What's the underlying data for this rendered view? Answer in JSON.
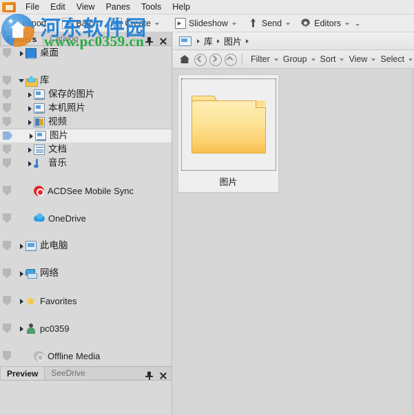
{
  "menu": {
    "logo_icon": "acdsee-logo-icon",
    "items": [
      {
        "label": "File"
      },
      {
        "label": "Edit"
      },
      {
        "label": "View"
      },
      {
        "label": "Panes"
      },
      {
        "label": "Tools"
      },
      {
        "label": "Help"
      }
    ]
  },
  "toolbar": {
    "buttons": [
      {
        "label": "Import",
        "icon": "import-icon",
        "has_caret": false
      },
      {
        "label": "Batch",
        "icon": "batch-icon",
        "has_caret": false
      },
      {
        "label": "Create",
        "icon": "create-icon",
        "has_caret": true
      },
      {
        "label": "Slideshow",
        "icon": "slideshow-icon",
        "has_caret": true
      },
      {
        "label": "Send",
        "icon": "send-icon",
        "has_caret": true
      },
      {
        "label": "Editors",
        "icon": "editors-icon",
        "has_caret": true
      }
    ],
    "overflow_caret": "chevron-down-icon"
  },
  "left_panel": {
    "tabs": [
      {
        "label": "Folders",
        "active": true
      },
      {
        "label": "Catalog",
        "active": false
      }
    ],
    "pin_icon": "pin-icon",
    "close_icon": "close-icon",
    "tree": [
      {
        "label": "桌面",
        "icon": "desktop-icon",
        "indent": 0,
        "arrow": "closed",
        "selected": false,
        "badge": true
      },
      {
        "label": "",
        "icon": "spacer",
        "indent": 0,
        "arrow": "none",
        "selected": false,
        "badge": false,
        "spacer": true
      },
      {
        "label": "库",
        "icon": "library-icon",
        "indent": 0,
        "arrow": "open",
        "selected": false,
        "badge": true
      },
      {
        "label": "保存的图片",
        "icon": "pictures-icon",
        "indent": 1,
        "arrow": "closed",
        "selected": false,
        "badge": true
      },
      {
        "label": "本机照片",
        "icon": "pictures-icon",
        "indent": 1,
        "arrow": "closed",
        "selected": false,
        "badge": true
      },
      {
        "label": "视频",
        "icon": "video-icon",
        "indent": 1,
        "arrow": "closed",
        "selected": false,
        "badge": true
      },
      {
        "label": "图片",
        "icon": "pictures-icon",
        "indent": 1,
        "arrow": "closed",
        "selected": true,
        "badge": true
      },
      {
        "label": "文档",
        "icon": "document-icon",
        "indent": 1,
        "arrow": "closed",
        "selected": false,
        "badge": true
      },
      {
        "label": "音乐",
        "icon": "music-icon",
        "indent": 1,
        "arrow": "closed",
        "selected": false,
        "badge": true
      },
      {
        "label": "",
        "icon": "spacer",
        "indent": 0,
        "arrow": "none",
        "selected": false,
        "badge": false,
        "spacer": true
      },
      {
        "label": "ACDSee Mobile Sync",
        "icon": "mobile-sync-icon",
        "indent": 1,
        "arrow": "none",
        "selected": false,
        "badge": true
      },
      {
        "label": "",
        "icon": "spacer",
        "indent": 0,
        "arrow": "none",
        "selected": false,
        "badge": false,
        "spacer": true
      },
      {
        "label": "OneDrive",
        "icon": "onedrive-icon",
        "indent": 1,
        "arrow": "none",
        "selected": false,
        "badge": true
      },
      {
        "label": "",
        "icon": "spacer",
        "indent": 0,
        "arrow": "none",
        "selected": false,
        "badge": false,
        "spacer": true
      },
      {
        "label": "此电脑",
        "icon": "this-pc-icon",
        "indent": 0,
        "arrow": "closed",
        "selected": false,
        "badge": true
      },
      {
        "label": "",
        "icon": "spacer",
        "indent": 0,
        "arrow": "none",
        "selected": false,
        "badge": false,
        "spacer": true
      },
      {
        "label": "网络",
        "icon": "network-icon",
        "indent": 0,
        "arrow": "closed",
        "selected": false,
        "badge": true
      },
      {
        "label": "",
        "icon": "spacer",
        "indent": 0,
        "arrow": "none",
        "selected": false,
        "badge": false,
        "spacer": true
      },
      {
        "label": "Favorites",
        "icon": "star-icon",
        "indent": 0,
        "arrow": "closed",
        "selected": false,
        "badge": true
      },
      {
        "label": "",
        "icon": "spacer",
        "indent": 0,
        "arrow": "none",
        "selected": false,
        "badge": false,
        "spacer": true
      },
      {
        "label": "pc0359",
        "icon": "user-icon",
        "indent": 0,
        "arrow": "closed",
        "selected": false,
        "badge": true
      },
      {
        "label": "",
        "icon": "spacer",
        "indent": 0,
        "arrow": "none",
        "selected": false,
        "badge": false,
        "spacer": true
      },
      {
        "label": "Offline Media",
        "icon": "offline-media-icon",
        "indent": 1,
        "arrow": "none",
        "selected": false,
        "badge": true
      }
    ]
  },
  "bottom_panel": {
    "tabs": [
      {
        "label": "Preview",
        "active": true
      },
      {
        "label": "SeeDrive",
        "active": false
      }
    ],
    "pin_icon": "pin-icon",
    "close_icon": "close-icon"
  },
  "right_panel": {
    "breadcrumb": {
      "root_icon": "computer-icon",
      "segments": [
        "库",
        "图片"
      ]
    },
    "viewbar": {
      "nav": [
        {
          "name": "home-icon"
        },
        {
          "name": "back-icon"
        },
        {
          "name": "forward-icon"
        },
        {
          "name": "up-icon"
        }
      ],
      "buttons": [
        {
          "label": "Filter"
        },
        {
          "label": "Group"
        },
        {
          "label": "Sort"
        },
        {
          "label": "View"
        },
        {
          "label": "Select"
        }
      ]
    },
    "items": [
      {
        "label": "图片",
        "icon": "folder-icon",
        "selected": true
      }
    ]
  },
  "watermark": {
    "cn_text": "河东软件园",
    "url_text": "www.pc0359.cn",
    "logo_icon": "watermark-house-logo-icon",
    "cn_color": "#1f7fd4",
    "url_color": "#1faa3c"
  }
}
